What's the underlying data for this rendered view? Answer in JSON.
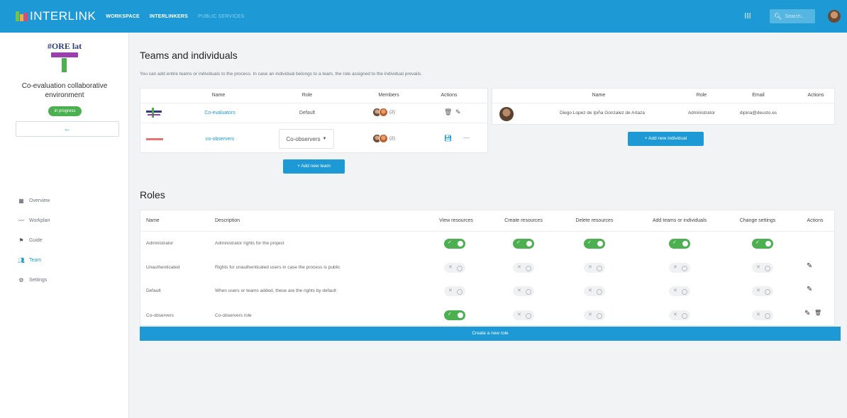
{
  "topbar": {
    "logo_text": "INTERLINK",
    "nav": [
      "WORKSPACE",
      "INTERLINKERS",
      "PUBLIC SERVICES"
    ],
    "search_placeholder": "Search...",
    "brand_color": "#1d9ad6"
  },
  "sidebar": {
    "project_logo_text": "#ORE lat",
    "project_title": "Co-evaluation collaborative environment",
    "status": "in progress",
    "back_label": "←",
    "items": [
      {
        "label": "Overview",
        "icon": "grid-icon"
      },
      {
        "label": "Workplan",
        "icon": "trend-icon"
      },
      {
        "label": "Guide",
        "icon": "guide-icon"
      },
      {
        "label": "Team",
        "icon": "team-icon"
      },
      {
        "label": "Settings",
        "icon": "gear-icon"
      }
    ]
  },
  "teams_section": {
    "title": "Teams and individuals",
    "description": "You can add entire teams or individuals to the process. In case an individual belongs to a team, the role assigned to the individual prevails.",
    "teams_headers": [
      "Name",
      "Role",
      "Members",
      "Actions"
    ],
    "teams": [
      {
        "name": "Co-evaluators",
        "role": "Default",
        "members": "(2)"
      },
      {
        "name": "co-observers",
        "role": "Co-observers",
        "members": "(2)"
      }
    ],
    "add_team_label": "+ Add new team",
    "individuals_headers": [
      "Name",
      "Role",
      "Email",
      "Actions"
    ],
    "individuals": [
      {
        "name": "Diego Lopez de Ipiña Gonzalez de Artaza",
        "role": "Administrator",
        "email": "dipina@deusto.es"
      }
    ],
    "add_individual_label": "+ Add new individual"
  },
  "roles_section": {
    "title": "Roles",
    "headers": [
      "Name",
      "Description",
      "View resources",
      "Create resources",
      "Delete resources",
      "Add teams or individuals",
      "Change settings",
      "Actions"
    ],
    "rows": [
      {
        "name": "Administrator",
        "description": "Administrator rights for the project",
        "perms": [
          true,
          true,
          true,
          true,
          true
        ],
        "actions": []
      },
      {
        "name": "Unauthenticated",
        "description": "Rights for unauthenticated users in case the process is public",
        "perms": [
          false,
          false,
          false,
          false,
          false
        ],
        "actions": [
          "edit"
        ]
      },
      {
        "name": "Default",
        "description": "When users or teams added, these are the rights by default",
        "perms": [
          false,
          false,
          false,
          false,
          false
        ],
        "actions": [
          "edit"
        ]
      },
      {
        "name": "Co-observers",
        "description": "Co-observers role",
        "perms": [
          true,
          false,
          false,
          false,
          false
        ],
        "actions": [
          "edit",
          "delete"
        ]
      }
    ],
    "create_role_label": "Create a new role"
  }
}
